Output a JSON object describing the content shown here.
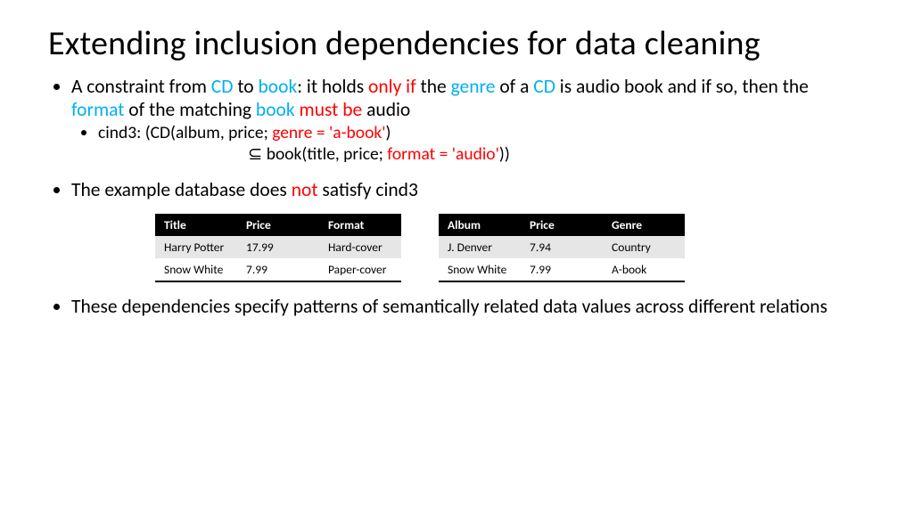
{
  "title": "Extending inclusion dependencies for data cleaning",
  "bullet1": {
    "p1": "A constraint from ",
    "cd": "CD",
    "p2": " to ",
    "book": "book",
    "p3": ": it holds ",
    "onlyif": "only if",
    "p4": " the ",
    "genre": "genre",
    "p5": " of a ",
    "cd2": "CD",
    "p6": " is audio book and if so, then the ",
    "format": "format",
    "p7": " of the matching ",
    "book2": "book",
    "p8": " ",
    "mustbe": "must be",
    "p9": " audio"
  },
  "cind3a": {
    "p1": "cind3: (CD(album, price; ",
    "genreEq": "genre = 'a-book'",
    "p2": ")"
  },
  "cind3b": {
    "p1": "⊆ book(title, price; ",
    "formatEq": "format = 'audio'",
    "p2": "))"
  },
  "bullet2": {
    "p1": "The example database does ",
    "not": "not",
    "p2": " satisfy cind3"
  },
  "bullet3": "These dependencies specify patterns of semantically related data values across different relations",
  "tableBook": {
    "headers": [
      "Title",
      "Price",
      "Format"
    ],
    "rows": [
      [
        "Harry Potter",
        "17.99",
        "Hard-cover"
      ],
      [
        "Snow White",
        "7.99",
        "Paper-cover"
      ]
    ]
  },
  "tableCD": {
    "headers": [
      "Album",
      "Price",
      "Genre"
    ],
    "rows": [
      [
        "J. Denver",
        "7.94",
        "Country"
      ],
      [
        "Snow White",
        "7.99",
        "A-book"
      ]
    ]
  },
  "chart_data": [
    {
      "type": "table",
      "title": "book",
      "columns": [
        "Title",
        "Price",
        "Format"
      ],
      "rows": [
        [
          "Harry Potter",
          17.99,
          "Hard-cover"
        ],
        [
          "Snow White",
          7.99,
          "Paper-cover"
        ]
      ]
    },
    {
      "type": "table",
      "title": "CD",
      "columns": [
        "Album",
        "Price",
        "Genre"
      ],
      "rows": [
        [
          "J. Denver",
          7.94,
          "Country"
        ],
        [
          "Snow White",
          7.99,
          "A-book"
        ]
      ]
    }
  ]
}
